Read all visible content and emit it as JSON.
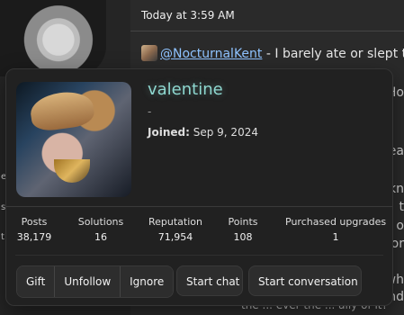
{
  "background": {
    "timestamp": "Today at 3:59 AM",
    "mention": "@NocturnalKent",
    "message_preview": " - I barely ate or slept thi",
    "snippet_right_1": "Ho",
    "snippet_right_2": "rea",
    "snippet_right_3": "kn",
    "snippet_right_4": "t",
    "snippet_right_5": "o",
    "snippet_right_6": "or",
    "snippet_right_7": "wh",
    "snippet_right_8": "nd",
    "left_letter_1": "e",
    "left_letter_2": "s",
    "left_letter_3": "t",
    "bottom_partial": "the ... ever the ... ally of it?"
  },
  "profile_card": {
    "username": "valentine",
    "title": "-",
    "joined_label": "Joined:",
    "joined_date": "Sep 9, 2024",
    "stats": [
      {
        "label": "Posts",
        "value": "38,179"
      },
      {
        "label": "Solutions",
        "value": "16"
      },
      {
        "label": "Reputation",
        "value": "71,954"
      },
      {
        "label": "Points",
        "value": "108"
      },
      {
        "label": "Purchased upgrades",
        "value": "1"
      }
    ],
    "actions": {
      "gift": "Gift",
      "unfollow": "Unfollow",
      "ignore": "Ignore",
      "start_chat": "Start chat",
      "start_conversation": "Start conversation"
    }
  },
  "colors": {
    "page_bg": "#2a2a2a",
    "card_bg": "#212121",
    "username": "#8ed8d0",
    "mention_link": "#8fc3ff",
    "button_bg": "#2d2d2d"
  }
}
